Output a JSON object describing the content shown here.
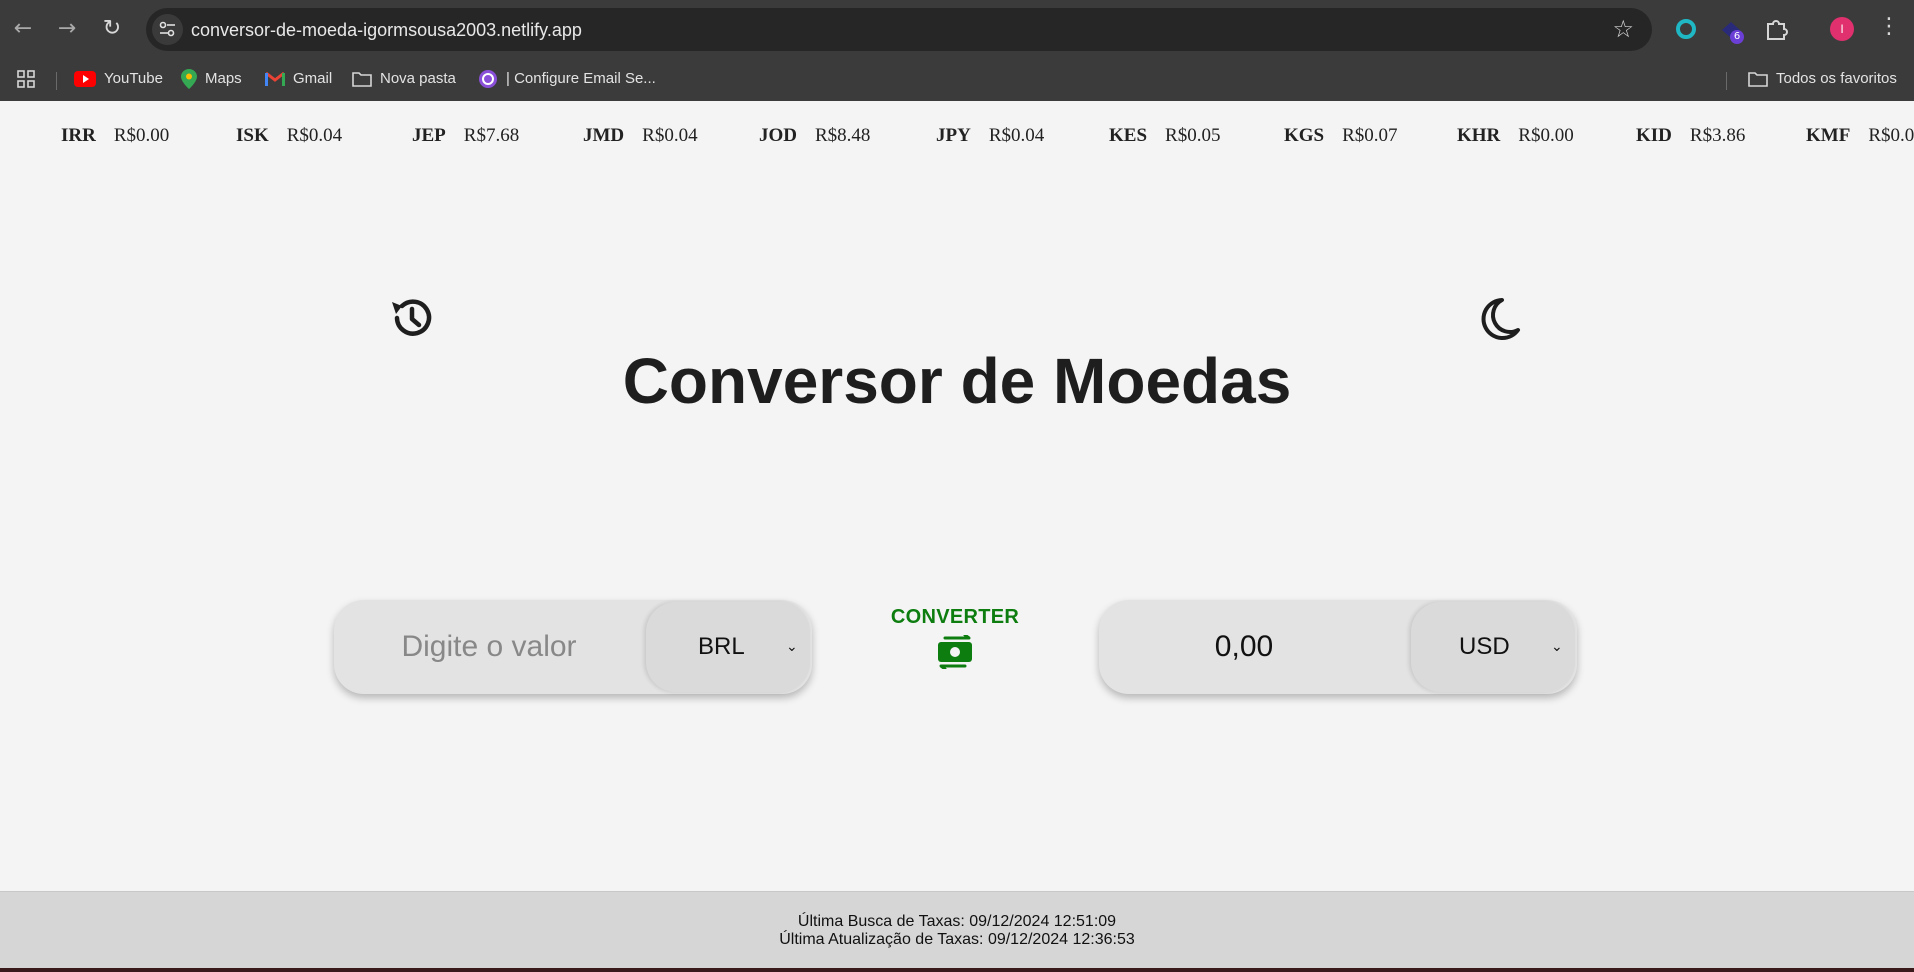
{
  "browser": {
    "url": "conversor-de-moeda-igormsousa2003.netlify.app",
    "extension_badge": "6",
    "avatar_initial": "I",
    "bookmarks": [
      {
        "label": "YouTube",
        "icon": "youtube-icon"
      },
      {
        "label": "Maps",
        "icon": "maps-icon"
      },
      {
        "label": "Gmail",
        "icon": "gmail-icon"
      },
      {
        "label": "Nova pasta",
        "icon": "folder-icon"
      },
      {
        "label": "| Configure Email Se...",
        "icon": "site-icon"
      }
    ],
    "all_bookmarks_label": "Todos os favoritos"
  },
  "ticker": [
    {
      "code": "IRR",
      "rate": "R$0.00"
    },
    {
      "code": "ISK",
      "rate": "R$0.04"
    },
    {
      "code": "JEP",
      "rate": "R$7.68"
    },
    {
      "code": "JMD",
      "rate": "R$0.04"
    },
    {
      "code": "JOD",
      "rate": "R$8.48"
    },
    {
      "code": "JPY",
      "rate": "R$0.04"
    },
    {
      "code": "KES",
      "rate": "R$0.05"
    },
    {
      "code": "KGS",
      "rate": "R$0.07"
    },
    {
      "code": "KHR",
      "rate": "R$0.00"
    },
    {
      "code": "KID",
      "rate": "R$3.86"
    },
    {
      "code": "KMF",
      "rate": "R$0.0"
    }
  ],
  "main": {
    "title": "Conversor de Moedas",
    "from": {
      "placeholder": "Digite o valor",
      "currency": "BRL"
    },
    "to": {
      "value": "0,00",
      "currency": "USD"
    },
    "convert_label": "CONVERTER",
    "accent_color": "#0e7d10"
  },
  "footer": {
    "last_fetch": "Última Busca de Taxas: 09/12/2024 12:51:09",
    "last_update": "Última Atualização de Taxas: 09/12/2024 12:36:53"
  }
}
